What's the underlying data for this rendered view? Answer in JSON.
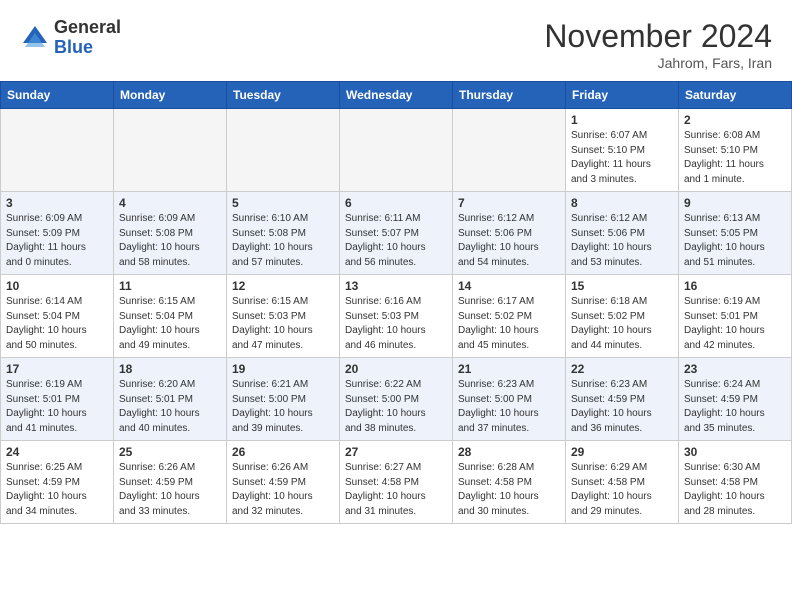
{
  "header": {
    "logo_general": "General",
    "logo_blue": "Blue",
    "month_title": "November 2024",
    "location": "Jahrom, Fars, Iran"
  },
  "weekdays": [
    "Sunday",
    "Monday",
    "Tuesday",
    "Wednesday",
    "Thursday",
    "Friday",
    "Saturday"
  ],
  "weeks": [
    [
      {
        "day": "",
        "info": ""
      },
      {
        "day": "",
        "info": ""
      },
      {
        "day": "",
        "info": ""
      },
      {
        "day": "",
        "info": ""
      },
      {
        "day": "",
        "info": ""
      },
      {
        "day": "1",
        "info": "Sunrise: 6:07 AM\nSunset: 5:10 PM\nDaylight: 11 hours\nand 3 minutes."
      },
      {
        "day": "2",
        "info": "Sunrise: 6:08 AM\nSunset: 5:10 PM\nDaylight: 11 hours\nand 1 minute."
      }
    ],
    [
      {
        "day": "3",
        "info": "Sunrise: 6:09 AM\nSunset: 5:09 PM\nDaylight: 11 hours\nand 0 minutes."
      },
      {
        "day": "4",
        "info": "Sunrise: 6:09 AM\nSunset: 5:08 PM\nDaylight: 10 hours\nand 58 minutes."
      },
      {
        "day": "5",
        "info": "Sunrise: 6:10 AM\nSunset: 5:08 PM\nDaylight: 10 hours\nand 57 minutes."
      },
      {
        "day": "6",
        "info": "Sunrise: 6:11 AM\nSunset: 5:07 PM\nDaylight: 10 hours\nand 56 minutes."
      },
      {
        "day": "7",
        "info": "Sunrise: 6:12 AM\nSunset: 5:06 PM\nDaylight: 10 hours\nand 54 minutes."
      },
      {
        "day": "8",
        "info": "Sunrise: 6:12 AM\nSunset: 5:06 PM\nDaylight: 10 hours\nand 53 minutes."
      },
      {
        "day": "9",
        "info": "Sunrise: 6:13 AM\nSunset: 5:05 PM\nDaylight: 10 hours\nand 51 minutes."
      }
    ],
    [
      {
        "day": "10",
        "info": "Sunrise: 6:14 AM\nSunset: 5:04 PM\nDaylight: 10 hours\nand 50 minutes."
      },
      {
        "day": "11",
        "info": "Sunrise: 6:15 AM\nSunset: 5:04 PM\nDaylight: 10 hours\nand 49 minutes."
      },
      {
        "day": "12",
        "info": "Sunrise: 6:15 AM\nSunset: 5:03 PM\nDaylight: 10 hours\nand 47 minutes."
      },
      {
        "day": "13",
        "info": "Sunrise: 6:16 AM\nSunset: 5:03 PM\nDaylight: 10 hours\nand 46 minutes."
      },
      {
        "day": "14",
        "info": "Sunrise: 6:17 AM\nSunset: 5:02 PM\nDaylight: 10 hours\nand 45 minutes."
      },
      {
        "day": "15",
        "info": "Sunrise: 6:18 AM\nSunset: 5:02 PM\nDaylight: 10 hours\nand 44 minutes."
      },
      {
        "day": "16",
        "info": "Sunrise: 6:19 AM\nSunset: 5:01 PM\nDaylight: 10 hours\nand 42 minutes."
      }
    ],
    [
      {
        "day": "17",
        "info": "Sunrise: 6:19 AM\nSunset: 5:01 PM\nDaylight: 10 hours\nand 41 minutes."
      },
      {
        "day": "18",
        "info": "Sunrise: 6:20 AM\nSunset: 5:01 PM\nDaylight: 10 hours\nand 40 minutes."
      },
      {
        "day": "19",
        "info": "Sunrise: 6:21 AM\nSunset: 5:00 PM\nDaylight: 10 hours\nand 39 minutes."
      },
      {
        "day": "20",
        "info": "Sunrise: 6:22 AM\nSunset: 5:00 PM\nDaylight: 10 hours\nand 38 minutes."
      },
      {
        "day": "21",
        "info": "Sunrise: 6:23 AM\nSunset: 5:00 PM\nDaylight: 10 hours\nand 37 minutes."
      },
      {
        "day": "22",
        "info": "Sunrise: 6:23 AM\nSunset: 4:59 PM\nDaylight: 10 hours\nand 36 minutes."
      },
      {
        "day": "23",
        "info": "Sunrise: 6:24 AM\nSunset: 4:59 PM\nDaylight: 10 hours\nand 35 minutes."
      }
    ],
    [
      {
        "day": "24",
        "info": "Sunrise: 6:25 AM\nSunset: 4:59 PM\nDaylight: 10 hours\nand 34 minutes."
      },
      {
        "day": "25",
        "info": "Sunrise: 6:26 AM\nSunset: 4:59 PM\nDaylight: 10 hours\nand 33 minutes."
      },
      {
        "day": "26",
        "info": "Sunrise: 6:26 AM\nSunset: 4:59 PM\nDaylight: 10 hours\nand 32 minutes."
      },
      {
        "day": "27",
        "info": "Sunrise: 6:27 AM\nSunset: 4:58 PM\nDaylight: 10 hours\nand 31 minutes."
      },
      {
        "day": "28",
        "info": "Sunrise: 6:28 AM\nSunset: 4:58 PM\nDaylight: 10 hours\nand 30 minutes."
      },
      {
        "day": "29",
        "info": "Sunrise: 6:29 AM\nSunset: 4:58 PM\nDaylight: 10 hours\nand 29 minutes."
      },
      {
        "day": "30",
        "info": "Sunrise: 6:30 AM\nSunset: 4:58 PM\nDaylight: 10 hours\nand 28 minutes."
      }
    ]
  ]
}
